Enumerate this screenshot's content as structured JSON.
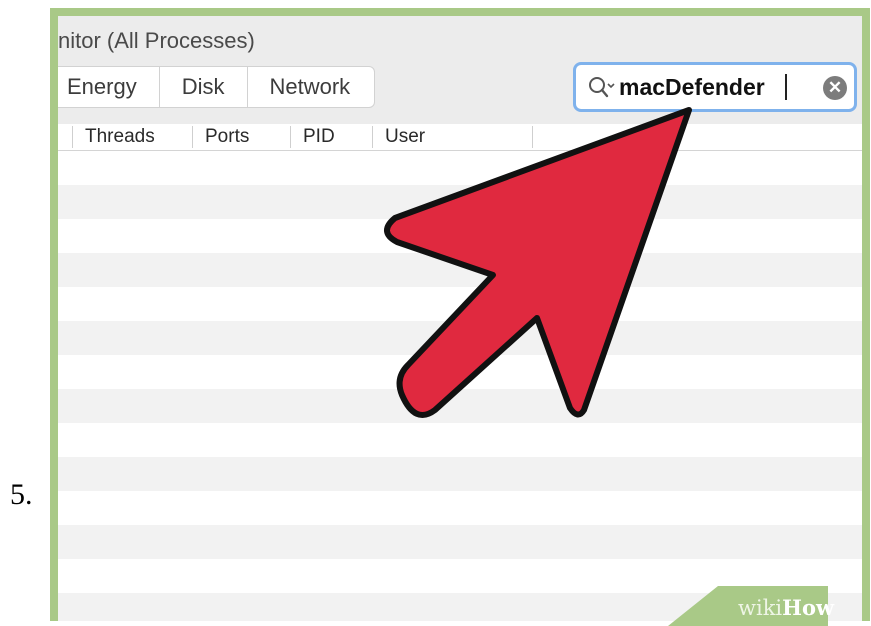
{
  "step_number": "5.",
  "window": {
    "title": "nitor (All Processes)",
    "tabs": [
      {
        "label": "Energy"
      },
      {
        "label": "Disk"
      },
      {
        "label": "Network"
      }
    ],
    "search": {
      "value": "macDefender",
      "icon": "magnifier-with-dropdown-icon",
      "clear_icon": "clear-x-icon"
    },
    "columns": [
      "Threads",
      "Ports",
      "PID",
      "User"
    ]
  },
  "watermark": {
    "part1": "wiki",
    "part2": "How"
  },
  "colors": {
    "frame": "#a9c987",
    "arrow_fill": "#e0293f",
    "arrow_stroke": "#111111",
    "search_focus": "#7fb2ec"
  }
}
